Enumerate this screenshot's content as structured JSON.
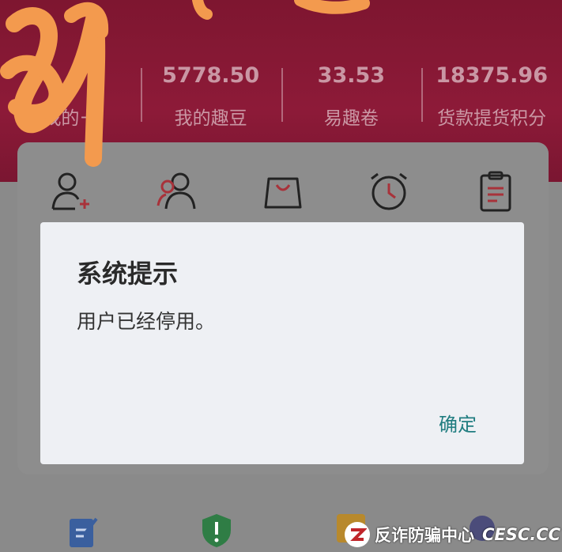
{
  "stats": [
    {
      "value": "",
      "label": "我的ㄧ"
    },
    {
      "value": "5778.50",
      "label": "我的趣豆"
    },
    {
      "value": "33.53",
      "label": "易趣卷"
    },
    {
      "value": "18375.96",
      "label": "货款提货积分"
    }
  ],
  "dialog": {
    "title": "系统提示",
    "message": "用户已经停用。",
    "ok_label": "确定"
  },
  "watermark": {
    "org": "反诈防骗中心",
    "site": "CESC.CC"
  },
  "colors": {
    "header": "#8d1a38",
    "accent": "#207d80",
    "scribble": "#f39a4e"
  }
}
